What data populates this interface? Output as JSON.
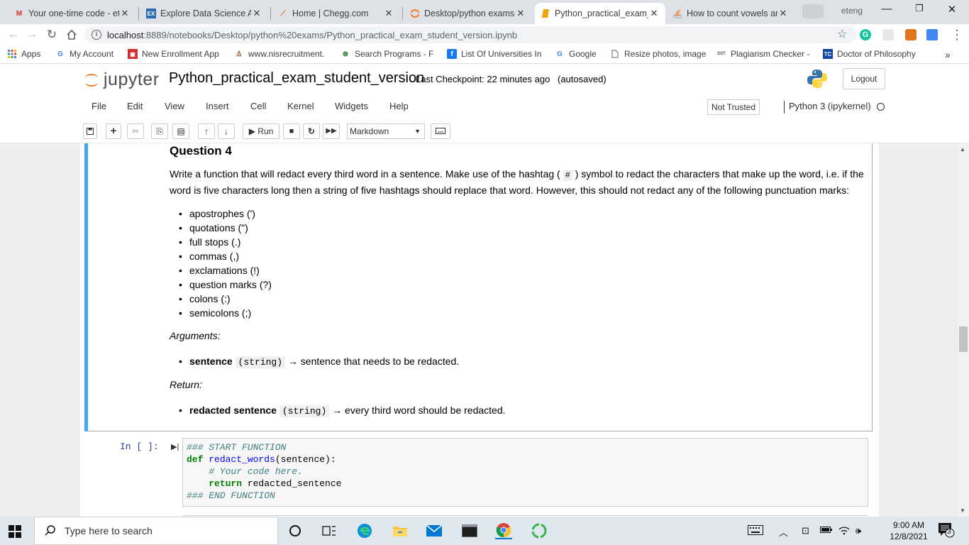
{
  "browser": {
    "tabs": [
      {
        "title": "Your one-time code - et",
        "icon": "gmail-icon"
      },
      {
        "title": "Explore Data Science Ac",
        "icon": "ex-icon"
      },
      {
        "title": "Home | Chegg.com",
        "icon": "chegg-icon"
      },
      {
        "title": "Desktop/python exams",
        "icon": "jupyter-icon"
      },
      {
        "title": "Python_practical_exam_",
        "icon": "notebook-icon"
      },
      {
        "title": "How to count vowels ar",
        "icon": "stackoverflow-icon"
      }
    ],
    "profile": "eteng",
    "url_host": "localhost",
    "url_path": ":8889/notebooks/Desktop/python%20exams/Python_practical_exam_student_version.ipynb",
    "bookmarks": [
      {
        "label": "Apps",
        "icon": "apps-grid-icon"
      },
      {
        "label": "My Account",
        "icon": "google-icon"
      },
      {
        "label": "New Enrollment App",
        "icon": "enrollment-icon"
      },
      {
        "label": "www.nisrecruitment.",
        "icon": "nis-icon"
      },
      {
        "label": "Search Programs - F",
        "icon": "programs-icon"
      },
      {
        "label": "List Of Universities In",
        "icon": "facebook-icon"
      },
      {
        "label": "Google",
        "icon": "google-icon"
      },
      {
        "label": "Resize photos, image",
        "icon": "page-icon"
      },
      {
        "label": "Plagiarism Checker -",
        "icon": "sst-icon"
      },
      {
        "label": "Doctor of Philosophy",
        "icon": "tc-icon"
      }
    ]
  },
  "jupyter": {
    "logo_text": "jupyter",
    "notebook_name": "Python_practical_exam_student_version",
    "checkpoint": "Last Checkpoint: 22 minutes ago",
    "autosave": "(autosaved)",
    "logout": "Logout",
    "menu": [
      "File",
      "Edit",
      "View",
      "Insert",
      "Cell",
      "Kernel",
      "Widgets",
      "Help"
    ],
    "trust": "Not Trusted",
    "kernel": "Python 3 (ipykernel)",
    "run_label": "Run",
    "cell_type": "Markdown"
  },
  "cell_md": {
    "heading": "Question 4",
    "para_a": "Write a function that will redact every third word in a sentence. Make use of the hashtag (",
    "hashtag": "#",
    "para_b": ") symbol to redact the characters that make up the word, i.e. if the",
    "para_c": "word is five characters long then a string of five hashtags should replace that word. However, this should not redact any of the following punctuation marks:",
    "punct": [
      "apostrophes (')",
      "quotations (\")",
      "full stops (.)",
      "commas (,)",
      "exclamations (!)",
      "question marks (?)",
      "colons (:)",
      "semicolons (;)"
    ],
    "args_label": "Arguments:",
    "arg_name": "sentence",
    "arg_type": "(string)",
    "arg_desc": "→ sentence that needs to be redacted.",
    "return_label": "Return:",
    "ret_name": "redacted sentence",
    "ret_type": "(string)",
    "ret_desc": "→ every third word should be redacted."
  },
  "cell_code": {
    "prompt": "In [ ]:",
    "l1": "### START FUNCTION",
    "l2_kw": "def",
    "l2_fn": "redact_words",
    "l2_rest": "(sentence):",
    "l3": "    # Your code here.",
    "l4_kw": "return",
    "l4_rest": " redacted_sentence",
    "l5": "### END FUNCTION"
  },
  "taskbar": {
    "search_placeholder": "Type here to search",
    "time": "9:00 AM",
    "date": "12/8/2021",
    "notifications": "3"
  }
}
